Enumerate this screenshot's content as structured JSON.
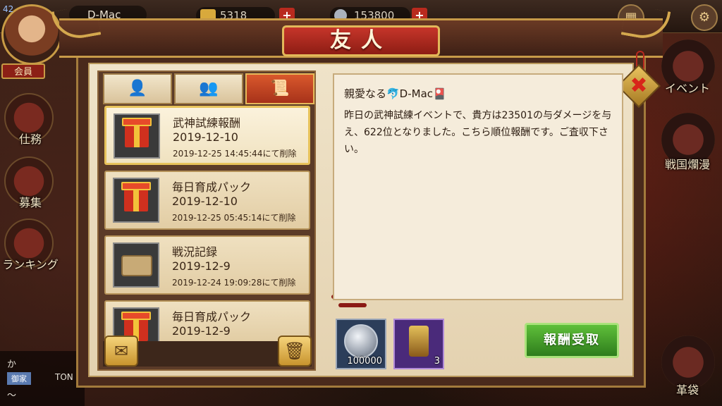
{
  "hud": {
    "level": "42",
    "player_name": "D-Mac",
    "gold": "5318",
    "silver": "153800",
    "member_label": "会員",
    "left_menu": [
      "仕務",
      "募集",
      "ランキング"
    ],
    "right_menu": [
      "イベント",
      "戦国爛漫",
      "革袋"
    ],
    "chat_line1": "か",
    "chat_tag": "御家",
    "chat_name": "TON",
    "chat_line2": "〜"
  },
  "dialog": {
    "title": "友人",
    "close_icon": "close-icon",
    "tabs": [
      {
        "icon": "friend-clock-icon",
        "glyph": "👤"
      },
      {
        "icon": "friends-icon",
        "glyph": "👥"
      },
      {
        "icon": "system-mail-icon",
        "glyph": "📜"
      }
    ],
    "mails": [
      {
        "title": "武神試練報酬",
        "date": "2019-12-10",
        "delete_note": "2019-12-25 14:45:44にて削除",
        "icon": "gift"
      },
      {
        "title": "毎日育成パック",
        "date": "2019-12-10",
        "delete_note": "2019-12-25 05:45:14にて削除",
        "icon": "gift"
      },
      {
        "title": "戦況記録",
        "date": "2019-12-9",
        "delete_note": "2019-12-24 19:09:28にて削除",
        "icon": "scroll"
      },
      {
        "title": "毎日育成パック",
        "date": "2019-12-9",
        "delete_note": "",
        "icon": "gift"
      }
    ],
    "detail": {
      "greeting": "親愛なる🐬D-Mac🎴",
      "body": "昨日の武神試練イベントで、貴方は23501の与ダメージを与え、622位となりました。こちら順位報酬です。ご査収下さい。"
    },
    "rewards": [
      {
        "icon": "silver-coin-icon",
        "qty": "100000"
      },
      {
        "icon": "banner-item-icon",
        "qty": "3"
      }
    ],
    "claim_label": "報酬受取"
  }
}
